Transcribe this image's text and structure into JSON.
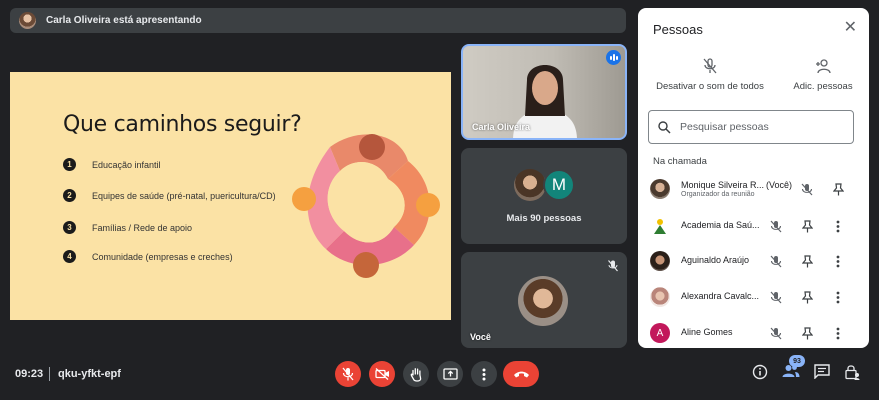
{
  "banner": {
    "text": "Carla Oliveira está apresentando"
  },
  "slide": {
    "title": "Que caminhos seguir?",
    "items": [
      {
        "num": "1",
        "text": "Educação infantil"
      },
      {
        "num": "2",
        "text": "Equipes de saúde (pré-natal, puericultura/CD)"
      },
      {
        "num": "3",
        "text": "Famílias / Rede de apoio"
      },
      {
        "num": "4",
        "text": "Comunidade (empresas e creches)"
      }
    ]
  },
  "tiles": {
    "presenter_name": "Carla Oliveira",
    "more_initial": "M",
    "more_label": "Mais 90 pessoas",
    "self_name": "Você"
  },
  "panel": {
    "title": "Pessoas",
    "mute_all": "Desativar o som de todos",
    "add_people": "Adic. pessoas",
    "search_placeholder": "Pesquisar pessoas",
    "section": "Na chamada",
    "people": [
      {
        "name": "Monique Silveira R...",
        "you": "(Você)",
        "role": "Organizador da reunião",
        "avatar_color": "#7a6a5c"
      },
      {
        "name": "Academia da Saú...",
        "avatar_color": "#ffffff"
      },
      {
        "name": "Aguinaldo Araújo",
        "avatar_color": "#4a3a2e"
      },
      {
        "name": "Alexandra Cavalc...",
        "avatar_color": "#d9c5c0"
      },
      {
        "name": "Aline Gomes",
        "initial": "A",
        "avatar_color": "#c2185b"
      }
    ]
  },
  "bottom": {
    "time": "09:23",
    "meeting_code": "qku-yfkt-epf",
    "participant_count": "93"
  },
  "colors": {
    "accent": "#8ab4f8",
    "danger": "#ea4335",
    "slide_bg": "#fbe2a5"
  }
}
